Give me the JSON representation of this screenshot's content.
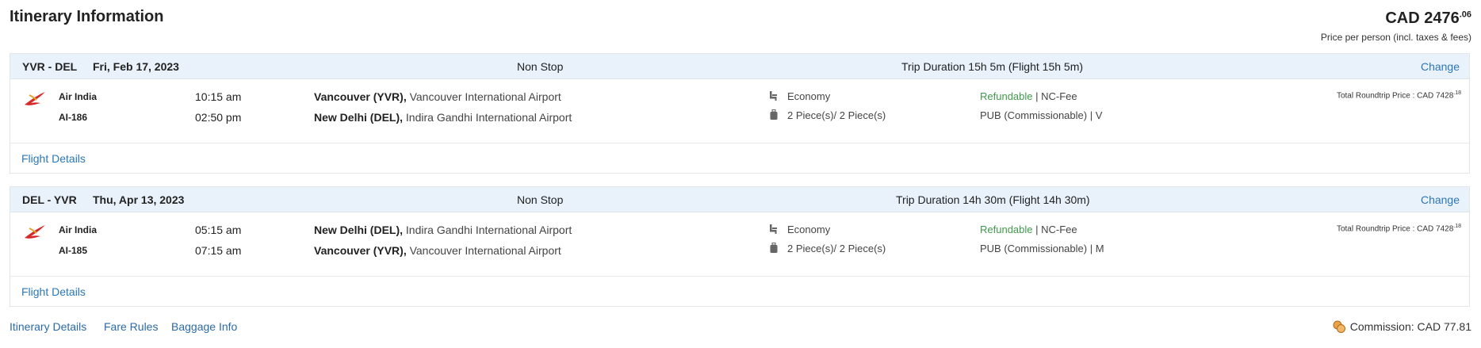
{
  "header": {
    "title": "Itinerary Information",
    "price_main": "CAD 2476",
    "price_cents": ".06",
    "price_note": "Price per person (incl. taxes & fees)"
  },
  "segments": [
    {
      "route": "YVR - DEL",
      "date": "Fri, Feb 17, 2023",
      "stops": "Non Stop",
      "duration": "Trip Duration 15h 5m (Flight 15h 5m)",
      "change": "Change",
      "airline": "Air India",
      "flight_no": "AI-186",
      "depart_time": "10:15 am",
      "arrive_time": "02:50 pm",
      "from_city": "Vancouver (YVR),",
      "from_airport": "Vancouver International Airport",
      "to_city": "New Delhi (DEL),",
      "to_airport": "Indira Gandhi International Airport",
      "cabin": "Economy",
      "baggage": "2 Piece(s)/ 2 Piece(s)",
      "refundable": "Refundable",
      "fee": "NC-Fee",
      "fare_type": "PUB (Commissionable)",
      "booking_class": "V",
      "total_label": "Total Roundtrip Price : CAD 7428",
      "total_cents": ".18",
      "flight_details": "Flight Details"
    },
    {
      "route": "DEL - YVR",
      "date": "Thu, Apr 13, 2023",
      "stops": "Non Stop",
      "duration": "Trip Duration 14h 30m (Flight 14h 30m)",
      "change": "Change",
      "airline": "Air India",
      "flight_no": "AI-185",
      "depart_time": "05:15 am",
      "arrive_time": "07:15 am",
      "from_city": "New Delhi (DEL),",
      "from_airport": "Indira Gandhi International Airport",
      "to_city": "Vancouver (YVR),",
      "to_airport": "Vancouver International Airport",
      "cabin": "Economy",
      "baggage": "2 Piece(s)/ 2 Piece(s)",
      "refundable": "Refundable",
      "fee": "NC-Fee",
      "fare_type": "PUB (Commissionable)",
      "booking_class": "M",
      "total_label": "Total Roundtrip Price : CAD 7428",
      "total_cents": ".18",
      "flight_details": "Flight Details"
    }
  ],
  "footer": {
    "links": [
      "Itinerary Details",
      "Fare Rules",
      "Baggage Info"
    ],
    "commission": "Commission: CAD 77.81"
  },
  "icons": {
    "airline_logo": "air-india-logo",
    "cabin": "seat-icon",
    "baggage": "luggage-icon",
    "commission": "coins-icon"
  },
  "colors": {
    "accent": "#2b77b8",
    "header_bg": "#e9f2fb",
    "refundable": "#3f9a4a",
    "logo": "#d42a2a"
  }
}
